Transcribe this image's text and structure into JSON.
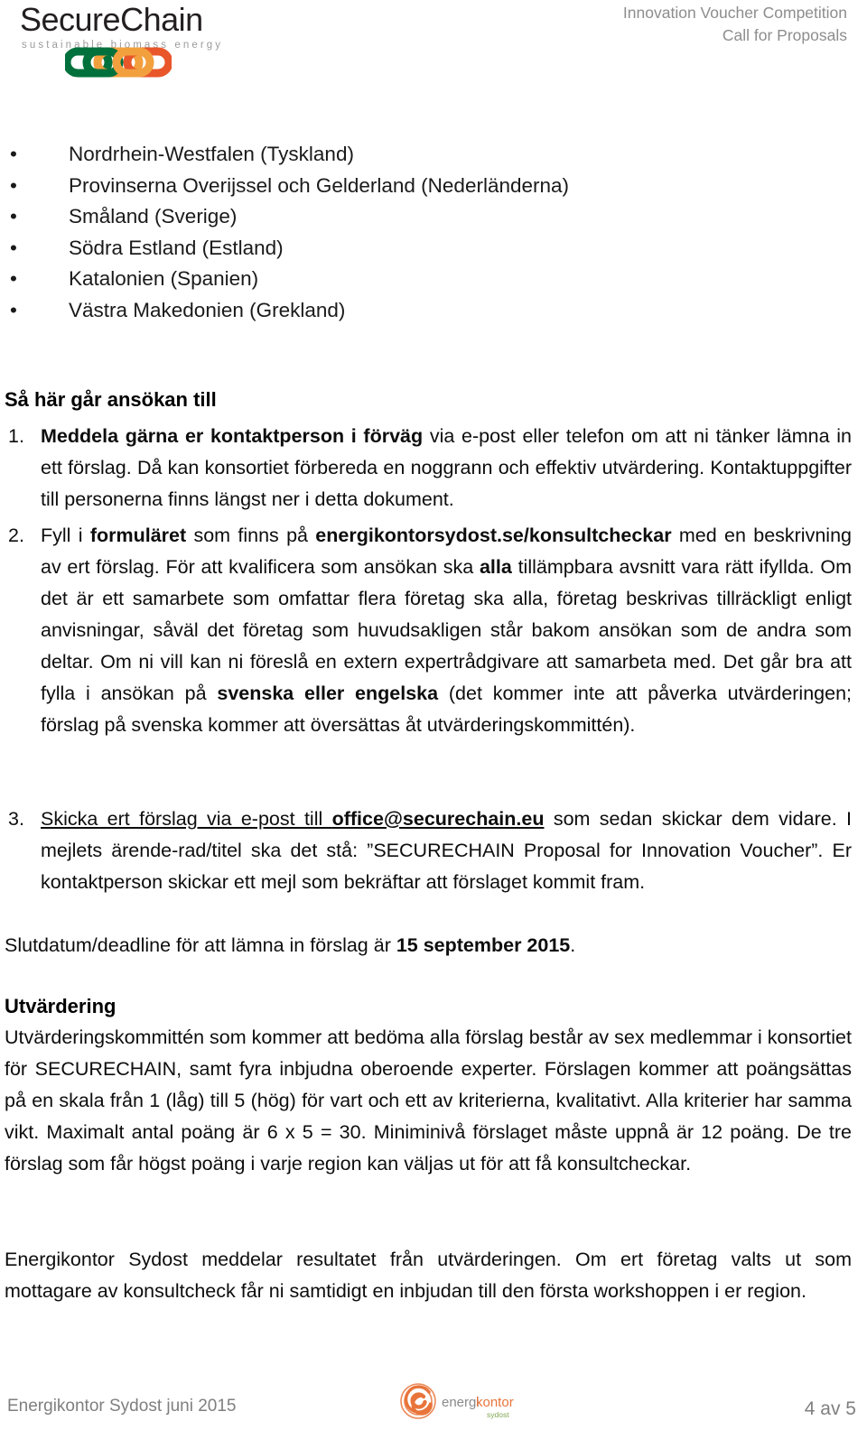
{
  "header": {
    "brand_name": "SecureChain",
    "brand_tagline": "sustainable biomass energy",
    "logo_alt": "chain-logo",
    "right_line1": "Innovation Voucher Competition",
    "right_line2": "Call for Proposals",
    "right_color": "#8d8d8d",
    "chain_colors": [
      "#00713c",
      "#f2a03d",
      "#e8562a"
    ]
  },
  "regions": {
    "items": [
      "Nordrhein-Westfalen (Tyskland)",
      "Provinserna Overijssel och Gelderland (Nederländerna)",
      "Småland (Sverige)",
      "Södra Estland (Estland)",
      "Katalonien (Spanien)",
      "Västra Makedonien (Grekland)"
    ],
    "bullet_glyph": "•"
  },
  "how_to_apply": {
    "heading": "Så här går ansökan till",
    "steps": [
      {
        "number": "1.",
        "bold_lead": "Meddela gärna er kontaktperson i förväg",
        "rest": " via e-post eller telefon om att ni tänker lämna in ett förslag. Då kan konsortiet förbereda en noggrann och effektiv utvärdering. Kontaktuppgifter till personerna finns längst ner i detta dokument."
      },
      {
        "number": "2.",
        "p1": "Fyll i ",
        "b1": "formuläret",
        "p2": " som finns på ",
        "b2": "energikontorsydost.se/konsultcheckar",
        "p3": " med en beskrivning av ert förslag. För att kvalificera som ansökan ska ",
        "b3": "alla",
        "p4": " tillämpbara avsnitt vara rätt ifyllda. Om det är ett samarbete som omfattar flera företag ska alla, företag beskrivas tillräckligt enligt anvisningar, såväl det företag som huvudsakligen står bakom ansökan som de andra som deltar. Om ni vill kan ni föreslå en extern expertrådgivare att samarbeta med. Det går bra att fylla i ansökan på ",
        "b4": "svenska eller engelska",
        "p5": " (det kommer inte att påverka utvärderingen; förslag på svenska kommer att översättas åt utvärderingskommittén)."
      },
      {
        "number": "3.",
        "u1": "Skicka ert förslag via e-post till ",
        "ub1": "office@securechain.eu",
        "p2": " som sedan skickar dem vidare. I mejlets ärende-rad/titel ska det stå: ”SECURECHAIN Proposal for Innovation Voucher”. Er kontaktperson skickar ett mejl som bekräftar att förslaget kommit fram."
      }
    ]
  },
  "deadline": {
    "lead": "Slutdatum/deadline för att lämna in förslag är ",
    "date": "15 september 2015",
    "trail": "."
  },
  "evaluation": {
    "heading": "Utvärdering",
    "paragraph": "Utvärderingskommittén som kommer att bedöma alla förslag består av sex medlemmar i konsortiet för SECURECHAIN, samt fyra inbjudna oberoende experter. Förslagen kommer att poängsättas på en skala från 1 (låg) till 5 (hög) för vart och ett av kriterierna, kvalitativt. Alla kriterier har samma vikt. Maximalt antal poäng är 6 x 5 = 30. Miniminivå förslaget måste uppnå är 12 poäng. De tre förslag som får högst poäng i varje region kan väljas ut för att få konsultcheckar."
  },
  "result_notice": {
    "paragraph": "Energikontor Sydost meddelar resultatet från utvärderingen. Om ert företag valts ut som mottagare av konsultcheck får ni samtidigt en inbjudan till den första workshoppen i er region."
  },
  "footer": {
    "left_text": "Energikontor Sydost juni 2015",
    "page_number": "4 av 5",
    "logo_word_a": "energi",
    "logo_word_b": "kontor",
    "logo_word_c": "sydost",
    "logo_color_a": "#8a8a8a",
    "logo_color_b": "#e8743b",
    "logo_color_c": "#7fa650",
    "text_color": "#7f7f7f"
  }
}
